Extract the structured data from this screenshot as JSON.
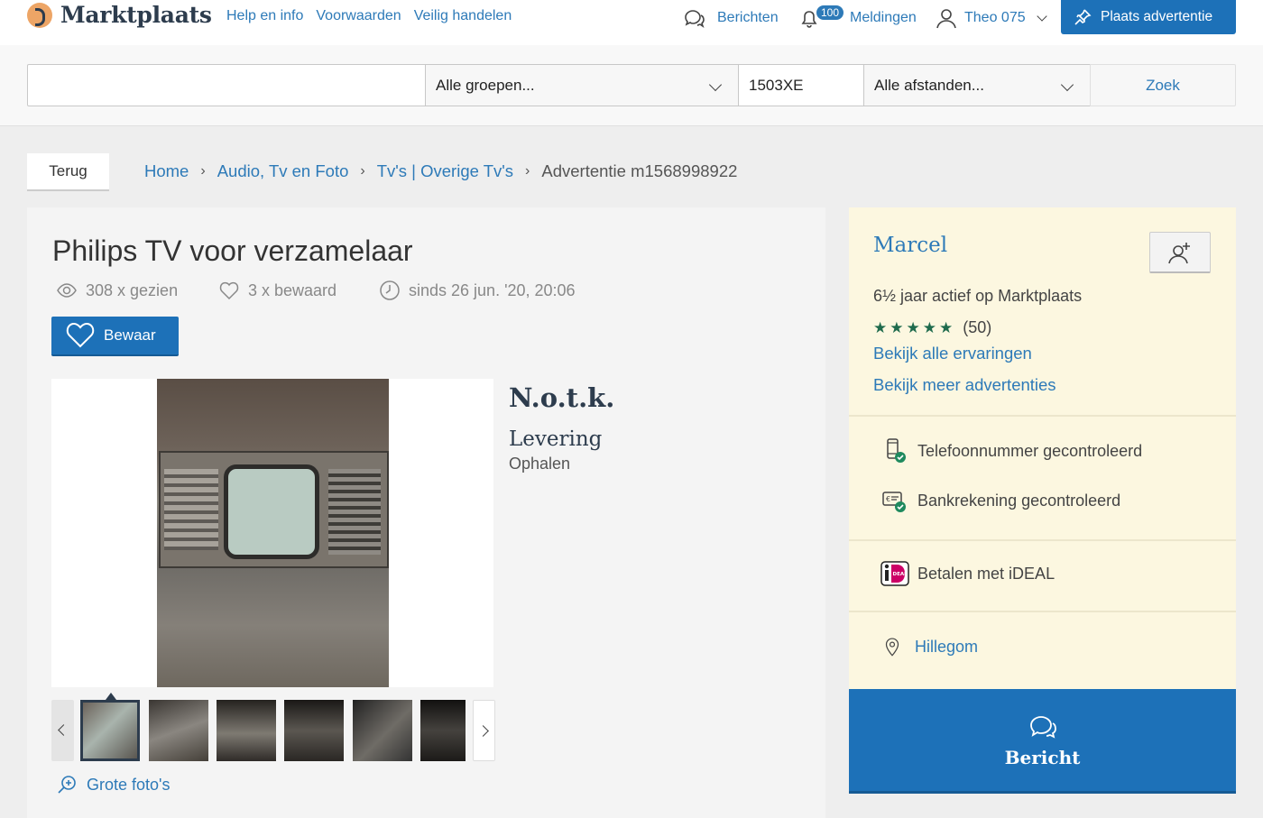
{
  "header": {
    "brand": "Marktplaats",
    "links": [
      "Help en info",
      "Voorwaarden",
      "Veilig handelen"
    ],
    "messages_label": "Berichten",
    "notifications_count": "100",
    "notifications_label": "Meldingen",
    "user_label": "Theo 075",
    "place_ad_label": "Plaats advertentie"
  },
  "search": {
    "query_value": "",
    "group_value": "Alle groepen...",
    "zip_value": "1503XE",
    "distance_value": "Alle afstanden...",
    "submit_label": "Zoek"
  },
  "breadcrumb": {
    "back_label": "Terug",
    "items": [
      "Home",
      "Audio, Tv en Foto",
      "Tv's | Overige Tv's"
    ],
    "current": "Advertentie m1568998922"
  },
  "listing": {
    "title": "Philips TV voor verzamelaar",
    "views": "308 x gezien",
    "saved": "3 x bewaard",
    "since": "sinds 26 jun. '20, 20:06",
    "save_label": "Bewaar",
    "price": "N.o.t.k.",
    "delivery_label": "Levering",
    "delivery_value": "Ophalen",
    "large_photos_label": "Grote foto's",
    "thumbnail_count": 6
  },
  "seller": {
    "name": "Marcel",
    "active_since": "6½ jaar actief op Marktplaats",
    "stars": "★★★★★",
    "reviews": "(50)",
    "link_reviews": "Bekijk alle ervaringen",
    "link_more_ads": "Bekijk meer advertenties",
    "phone_verified": "Telefoonnummer gecontroleerd",
    "bank_verified": "Bankrekening gecontroleerd",
    "payment": "Betalen met iDEAL",
    "location": "Hillegom",
    "message_button": "Bericht"
  },
  "colors": {
    "brand_blue": "#1d71b8",
    "link_blue": "#2d7ab8",
    "seller_bg": "#fcf7e0",
    "check_green": "#1f8a5e"
  }
}
